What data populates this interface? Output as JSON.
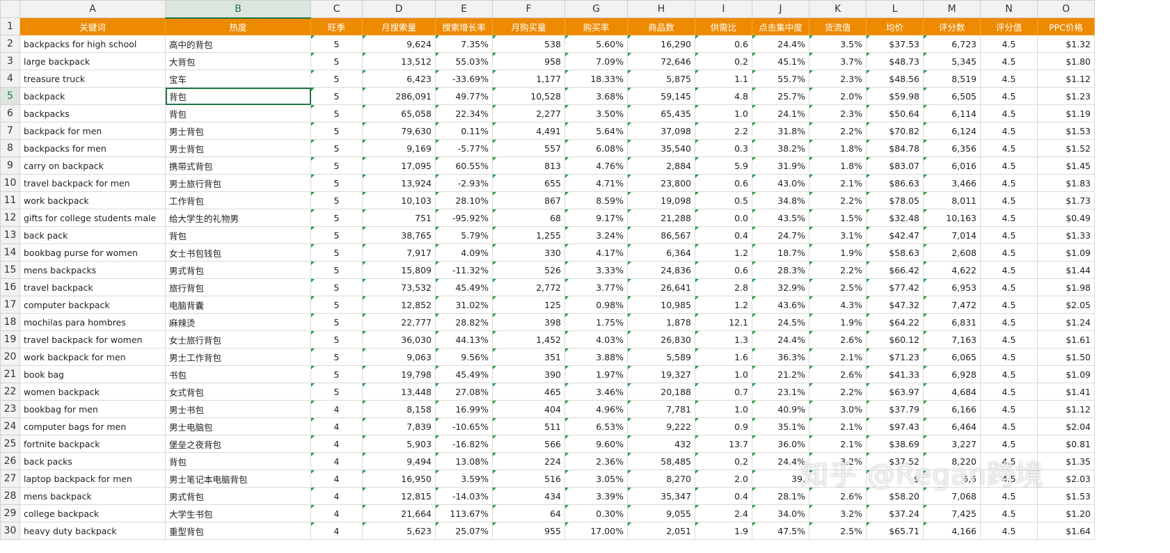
{
  "columns": [
    "A",
    "B",
    "C",
    "D",
    "E",
    "F",
    "G",
    "H",
    "I",
    "J",
    "K",
    "L",
    "M",
    "N",
    "O"
  ],
  "selected_column": "B",
  "selected_row": 5,
  "headers": [
    "关键词",
    "热度",
    "旺季",
    "月搜索量",
    "搜索增长率",
    "月购买量",
    "购买率",
    "商品数",
    "供需比",
    "点击集中度",
    "货流值",
    "均价",
    "评分数",
    "评分值",
    "PPC价格"
  ],
  "rows": [
    [
      "backpacks for high school",
      "高中的背包",
      "5",
      "9,624",
      "7.35%",
      "538",
      "5.60%",
      "16,290",
      "0.6",
      "24.4%",
      "3.5%",
      "$37.53",
      "6,723",
      "4.5",
      "$1.32"
    ],
    [
      "large backpack",
      "大背包",
      "5",
      "13,512",
      "55.03%",
      "958",
      "7.09%",
      "72,646",
      "0.2",
      "45.1%",
      "3.7%",
      "$48.73",
      "5,345",
      "4.5",
      "$1.80"
    ],
    [
      "treasure truck",
      "宝车",
      "5",
      "6,423",
      "-33.69%",
      "1,177",
      "18.33%",
      "5,875",
      "1.1",
      "55.7%",
      "2.3%",
      "$48.56",
      "8,519",
      "4.5",
      "$1.12"
    ],
    [
      "backpack",
      "背包",
      "5",
      "286,091",
      "49.77%",
      "10,528",
      "3.68%",
      "59,145",
      "4.8",
      "25.7%",
      "2.0%",
      "$59.98",
      "6,505",
      "4.5",
      "$1.23"
    ],
    [
      "backpacks",
      "背包",
      "5",
      "65,058",
      "22.34%",
      "2,277",
      "3.50%",
      "65,435",
      "1.0",
      "24.1%",
      "2.3%",
      "$50.64",
      "6,114",
      "4.5",
      "$1.19"
    ],
    [
      "backpack for men",
      "男士背包",
      "5",
      "79,630",
      "0.11%",
      "4,491",
      "5.64%",
      "37,098",
      "2.2",
      "31.8%",
      "2.2%",
      "$70.82",
      "6,124",
      "4.5",
      "$1.53"
    ],
    [
      "backpacks for men",
      "男士背包",
      "5",
      "9,169",
      "-5.77%",
      "557",
      "6.08%",
      "35,540",
      "0.3",
      "38.2%",
      "1.8%",
      "$84.78",
      "6,356",
      "4.5",
      "$1.52"
    ],
    [
      "carry on backpack",
      "携带式背包",
      "5",
      "17,095",
      "60.55%",
      "813",
      "4.76%",
      "2,884",
      "5.9",
      "31.9%",
      "1.8%",
      "$83.07",
      "6,016",
      "4.5",
      "$1.45"
    ],
    [
      "travel backpack for men",
      "男士旅行背包",
      "5",
      "13,924",
      "-2.93%",
      "655",
      "4.71%",
      "23,800",
      "0.6",
      "43.0%",
      "2.1%",
      "$86.63",
      "3,466",
      "4.5",
      "$1.83"
    ],
    [
      "work backpack",
      "工作背包",
      "5",
      "10,103",
      "28.10%",
      "867",
      "8.59%",
      "19,098",
      "0.5",
      "34.8%",
      "2.2%",
      "$78.05",
      "8,011",
      "4.5",
      "$1.73"
    ],
    [
      "gifts for college students male",
      "给大学生的礼物男",
      "5",
      "751",
      "-95.92%",
      "68",
      "9.17%",
      "21,288",
      "0.0",
      "43.5%",
      "1.5%",
      "$32.48",
      "10,163",
      "4.5",
      "$0.49"
    ],
    [
      "back pack",
      "背包",
      "5",
      "38,765",
      "5.79%",
      "1,255",
      "3.24%",
      "86,567",
      "0.4",
      "24.7%",
      "3.1%",
      "$42.47",
      "7,014",
      "4.5",
      "$1.33"
    ],
    [
      "bookbag purse for women",
      "女士书包钱包",
      "5",
      "7,917",
      "4.09%",
      "330",
      "4.17%",
      "6,364",
      "1.2",
      "18.7%",
      "1.9%",
      "$58.63",
      "2,608",
      "4.5",
      "$1.09"
    ],
    [
      "mens backpacks",
      "男式背包",
      "5",
      "15,809",
      "-11.32%",
      "526",
      "3.33%",
      "24,836",
      "0.6",
      "28.3%",
      "2.2%",
      "$66.42",
      "4,622",
      "4.5",
      "$1.44"
    ],
    [
      "travel backpack",
      "旅行背包",
      "5",
      "73,532",
      "45.49%",
      "2,772",
      "3.77%",
      "26,641",
      "2.8",
      "32.9%",
      "2.5%",
      "$77.42",
      "6,953",
      "4.5",
      "$1.98"
    ],
    [
      "computer backpack",
      "电脑背囊",
      "5",
      "12,852",
      "31.02%",
      "125",
      "0.98%",
      "10,985",
      "1.2",
      "43.6%",
      "4.3%",
      "$47.32",
      "7,472",
      "4.5",
      "$2.05"
    ],
    [
      "mochilas para hombres",
      "麻辣烫",
      "5",
      "22,777",
      "28.82%",
      "398",
      "1.75%",
      "1,878",
      "12.1",
      "24.5%",
      "1.9%",
      "$64.22",
      "6,831",
      "4.5",
      "$1.24"
    ],
    [
      "travel backpack for women",
      "女士旅行背包",
      "5",
      "36,030",
      "44.13%",
      "1,452",
      "4.03%",
      "26,830",
      "1.3",
      "24.4%",
      "2.6%",
      "$60.12",
      "7,163",
      "4.5",
      "$1.61"
    ],
    [
      "work backpack for men",
      "男士工作背包",
      "5",
      "9,063",
      "9.56%",
      "351",
      "3.88%",
      "5,589",
      "1.6",
      "36.3%",
      "2.1%",
      "$71.23",
      "6,065",
      "4.5",
      "$1.50"
    ],
    [
      "book bag",
      "书包",
      "5",
      "19,798",
      "45.49%",
      "390",
      "1.97%",
      "19,327",
      "1.0",
      "21.2%",
      "2.6%",
      "$41.33",
      "6,928",
      "4.5",
      "$1.09"
    ],
    [
      "women backpack",
      "女式背包",
      "5",
      "13,448",
      "27.08%",
      "465",
      "3.46%",
      "20,188",
      "0.7",
      "23.1%",
      "2.2%",
      "$63.97",
      "4,684",
      "4.5",
      "$1.41"
    ],
    [
      "bookbag for men",
      "男士书包",
      "4",
      "8,158",
      "16.99%",
      "404",
      "4.96%",
      "7,781",
      "1.0",
      "40.9%",
      "3.0%",
      "$37.79",
      "6,166",
      "4.5",
      "$1.12"
    ],
    [
      "computer bags for men",
      "男士电脑包",
      "4",
      "7,839",
      "-10.65%",
      "511",
      "6.53%",
      "9,222",
      "0.9",
      "35.1%",
      "2.1%",
      "$97.43",
      "6,464",
      "4.5",
      "$2.04"
    ],
    [
      "fortnite backpack",
      "堡垒之夜背包",
      "4",
      "5,903",
      "-16.82%",
      "566",
      "9.60%",
      "432",
      "13.7",
      "36.0%",
      "2.1%",
      "$38.69",
      "3,227",
      "4.5",
      "$0.81"
    ],
    [
      "back packs",
      "背包",
      "4",
      "9,494",
      "13.08%",
      "224",
      "2.36%",
      "58,485",
      "0.2",
      "24.4%",
      "3.2%",
      "$37.52",
      "8,220",
      "4.5",
      "$1.35"
    ],
    [
      "laptop backpack for men",
      "男士笔记本电脑背包",
      "4",
      "16,950",
      "3.59%",
      "516",
      "3.05%",
      "8,270",
      "2.0",
      "39.",
      "",
      "$",
      "6,6",
      "4.5",
      "$2.03"
    ],
    [
      "mens backpack",
      "男式背包",
      "4",
      "12,815",
      "-14.03%",
      "434",
      "3.39%",
      "35,347",
      "0.4",
      "28.1%",
      "2.6%",
      "$58.20",
      "7,068",
      "4.5",
      "$1.53"
    ],
    [
      "college backpack",
      "大学生书包",
      "4",
      "21,664",
      "113.67%",
      "64",
      "0.30%",
      "9,055",
      "2.4",
      "34.0%",
      "3.2%",
      "$37.24",
      "7,425",
      "4.5",
      "$1.20"
    ],
    [
      "heavy duty backpack",
      "重型背包",
      "4",
      "5,623",
      "25.07%",
      "955",
      "17.00%",
      "2,051",
      "1.9",
      "47.5%",
      "2.5%",
      "$65.71",
      "4,166",
      "4.5",
      "$1.64"
    ]
  ],
  "watermark": "知乎 @Regan跨境"
}
